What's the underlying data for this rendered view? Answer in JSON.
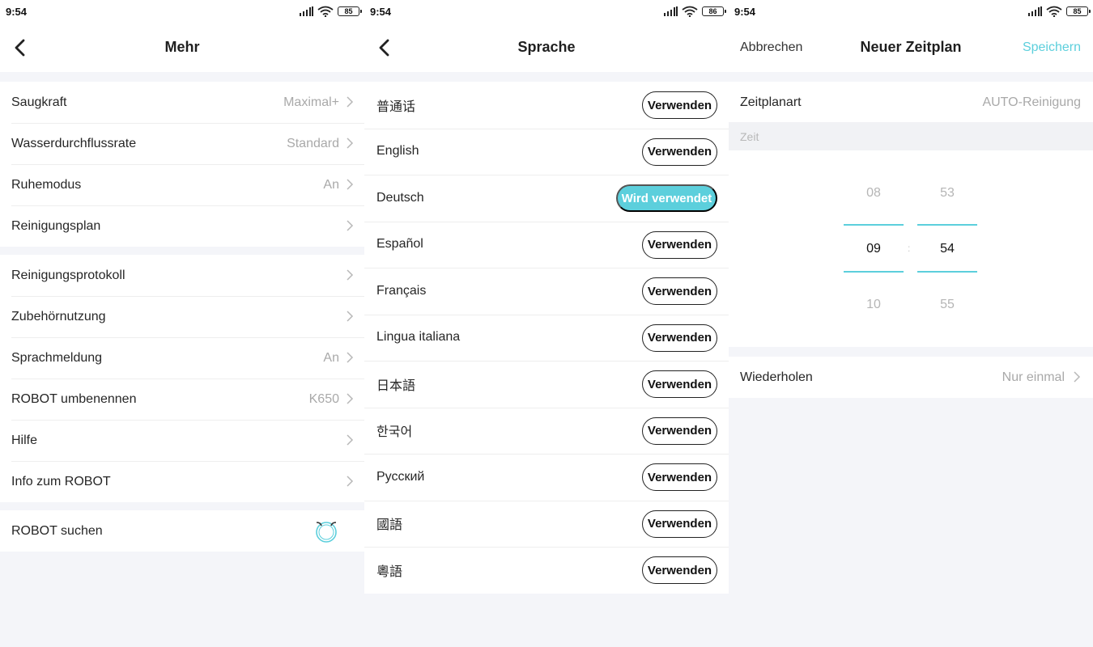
{
  "colors": {
    "accent": "#5ccfdc",
    "background": "#f4f5f9"
  },
  "screens": [
    {
      "status": {
        "time": "9:54",
        "battery": "85"
      },
      "title": "Mehr",
      "group1": [
        {
          "label": "Saugkraft",
          "value": "Maximal+"
        },
        {
          "label": "Wasserdurchflussrate",
          "value": "Standard"
        },
        {
          "label": "Ruhemodus",
          "value": "An"
        },
        {
          "label": "Reinigungsplan",
          "value": ""
        }
      ],
      "group2": [
        {
          "label": "Reinigungsprotokoll",
          "value": ""
        },
        {
          "label": "Zubehörnutzung",
          "value": ""
        },
        {
          "label": "Sprachmeldung",
          "value": "An"
        },
        {
          "label": "ROBOT umbenennen",
          "value": "K650"
        },
        {
          "label": "Hilfe",
          "value": ""
        },
        {
          "label": "Info zum ROBOT",
          "value": ""
        }
      ],
      "group3": [
        {
          "label": "ROBOT suchen",
          "icon": "robot-icon"
        }
      ]
    },
    {
      "status": {
        "time": "9:54",
        "battery": "86"
      },
      "title": "Sprache",
      "use_label": "Verwenden",
      "in_use_label": "Wird verwendet",
      "languages": [
        {
          "name": "普通话",
          "active": false
        },
        {
          "name": "English",
          "active": false
        },
        {
          "name": "Deutsch",
          "active": true
        },
        {
          "name": "Español",
          "active": false
        },
        {
          "name": "Français",
          "active": false
        },
        {
          "name": "Lingua italiana",
          "active": false
        },
        {
          "name": "日本語",
          "active": false
        },
        {
          "name": "한국어",
          "active": false
        },
        {
          "name": "Русский",
          "active": false
        },
        {
          "name": "國語",
          "active": false
        },
        {
          "name": "粵語",
          "active": false
        }
      ]
    },
    {
      "status": {
        "time": "9:54",
        "battery": "85"
      },
      "title": "Neuer Zeitplan",
      "cancel": "Abbrechen",
      "save": "Speichern",
      "schedule_type": {
        "label": "Zeitplanart",
        "value": "AUTO-Reinigung"
      },
      "time_section": "Zeit",
      "picker": {
        "hours": [
          "08",
          "09",
          "10"
        ],
        "minutes": [
          "53",
          "54",
          "55"
        ],
        "separator": ":"
      },
      "repeat": {
        "label": "Wiederholen",
        "value": "Nur einmal"
      }
    }
  ]
}
